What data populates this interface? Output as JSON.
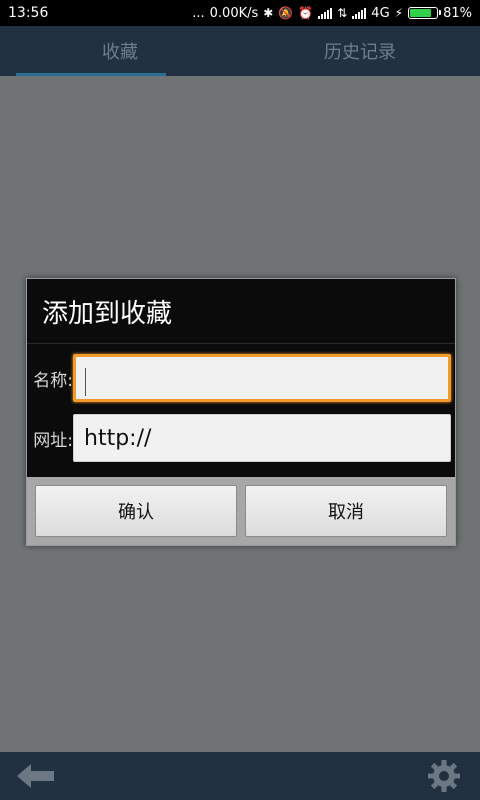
{
  "status_bar": {
    "time": "13:56",
    "dots": "...",
    "speed": "0.00K/s",
    "network": "4G",
    "battery_percent": "81%",
    "battery_level": 0.81
  },
  "tabs": [
    {
      "label": "收藏"
    },
    {
      "label": "历史记录"
    }
  ],
  "dialog": {
    "title": "添加到收藏",
    "name_label": "名称:",
    "name_value": "",
    "url_label": "网址:",
    "url_value": "http://",
    "confirm_label": "确认",
    "cancel_label": "取消"
  },
  "colors": {
    "focus_border": "#f29a2b",
    "tab_indicator": "#2c6f96"
  }
}
